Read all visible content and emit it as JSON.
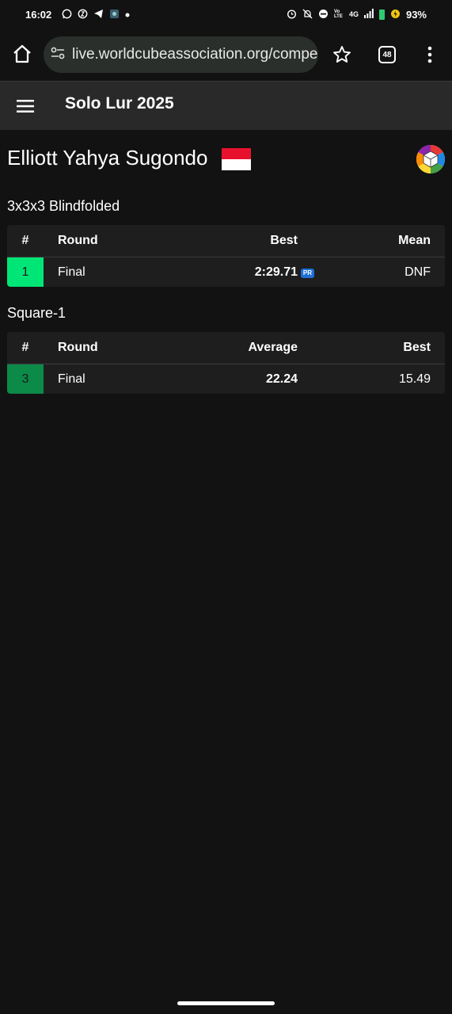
{
  "status_bar": {
    "time": "16:02",
    "network": "4G",
    "volte": "Vo LTE",
    "battery": "93%"
  },
  "browser": {
    "url": "live.worldcubeassociation.org/compe",
    "tab_count": "48"
  },
  "header": {
    "title": "Solo Lur 2025"
  },
  "person": {
    "name": "Elliott Yahya Sugondo"
  },
  "events": [
    {
      "title": "3x3x3 Blindfolded",
      "columns": [
        "#",
        "Round",
        "Best",
        "Mean"
      ],
      "rows": [
        {
          "rank": "1",
          "round": "Final",
          "mid": "2:29.71",
          "last": "DNF",
          "badge": "PR",
          "rank_color": "#00e676"
        }
      ]
    },
    {
      "title": "Square-1",
      "columns": [
        "#",
        "Round",
        "Average",
        "Best"
      ],
      "rows": [
        {
          "rank": "3",
          "round": "Final",
          "mid": "22.24",
          "last": "15.49",
          "rank_color": "#0c8a48"
        }
      ]
    }
  ],
  "colors": {
    "background": "#121212",
    "header_bg": "#292929",
    "table_bg": "#1e1e1e",
    "pr_badge": "#1e6fd9"
  }
}
